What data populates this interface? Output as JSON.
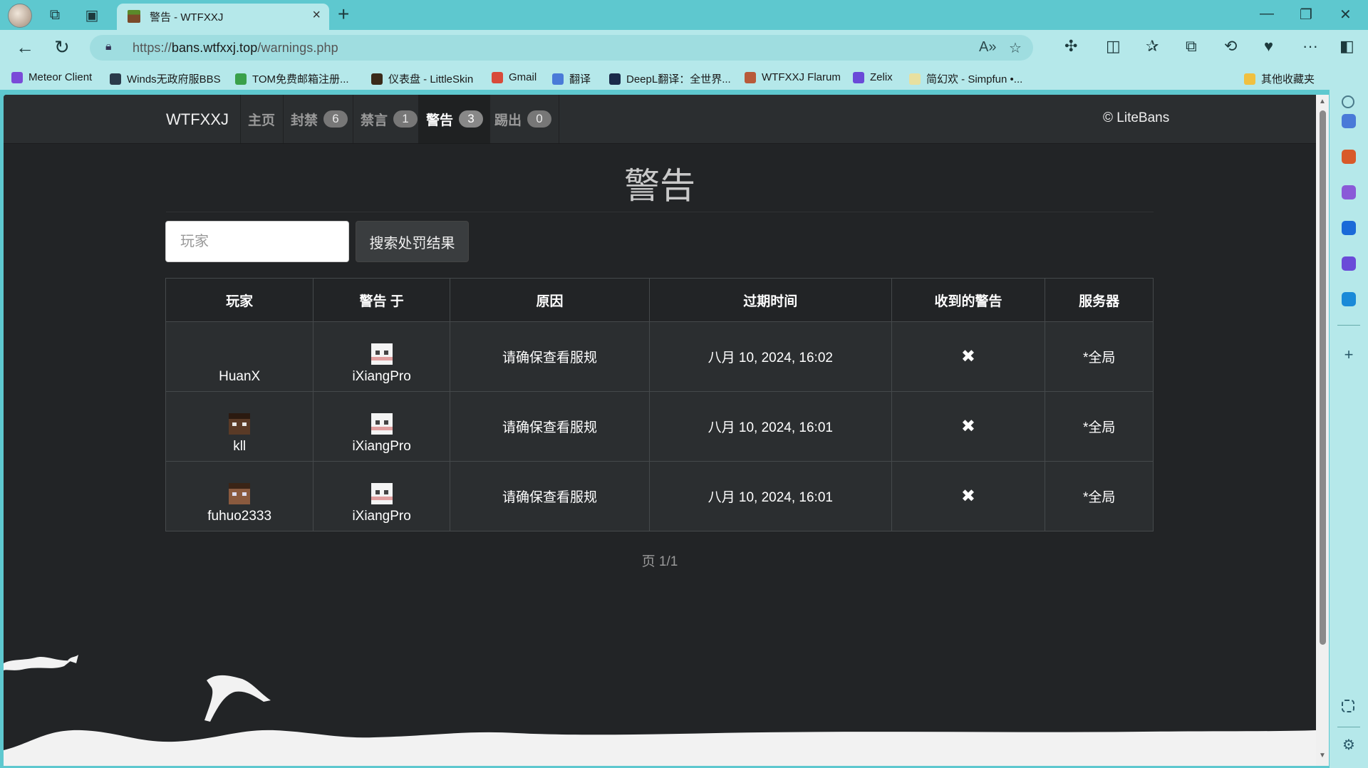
{
  "browser": {
    "tab_title": "警告 - WTFXXJ",
    "url_prefix": "https://",
    "url_host": "bans.wtfxxj.top",
    "url_path": "/warnings.php",
    "bookmarks": [
      {
        "label": "Meteor Client",
        "color": "#7a4bd8"
      },
      {
        "label": "Winds无政府服BBS",
        "color": "#2b3a4a"
      },
      {
        "label": "TOM免费邮箱注册...",
        "color": "#3aa04a"
      },
      {
        "label": "仪表盘 - LittleSkin",
        "color": "#3a2a1a"
      },
      {
        "label": "Gmail",
        "color": "#d84a3a"
      },
      {
        "label": "翻译",
        "color": "#4a7ad8"
      },
      {
        "label": "DeepL翻译：全世界...",
        "color": "#1a2a4a"
      },
      {
        "label": "WTFXXJ Flarum",
        "color": "#b85a3a"
      },
      {
        "label": "Zelix",
        "color": "#6a4ad8"
      },
      {
        "label": "简幻欢 - Simpfun •...",
        "color": "#e8e0a0"
      }
    ],
    "other_bookmarks": "其他收藏夹"
  },
  "site": {
    "brand": "WTFXXJ",
    "nav": [
      {
        "label": "主页",
        "count": ""
      },
      {
        "label": "封禁",
        "count": "6"
      },
      {
        "label": "禁言",
        "count": "1"
      },
      {
        "label": "警告",
        "count": "3"
      },
      {
        "label": "踢出",
        "count": "0"
      }
    ],
    "credit": "© LiteBans",
    "page_title": "警告",
    "search_placeholder": "玩家",
    "search_button": "搜索处罚结果",
    "columns": [
      "玩家",
      "警告 于",
      "原因",
      "过期时间",
      "收到的警告",
      "服务器"
    ],
    "rows": [
      {
        "player": "HuanX",
        "player_head": "blank",
        "by": "iXiangPro",
        "reason": "请确保查看服规",
        "expires": "八月 10, 2024, 16:02",
        "received": "✖",
        "server": "*全局"
      },
      {
        "player": "kll",
        "player_head": "dark",
        "by": "iXiangPro",
        "reason": "请确保查看服规",
        "expires": "八月 10, 2024, 16:01",
        "received": "✖",
        "server": "*全局"
      },
      {
        "player": "fuhuo2333",
        "player_head": "brown",
        "by": "iXiangPro",
        "reason": "请确保查看服规",
        "expires": "八月 10, 2024, 16:01",
        "received": "✖",
        "server": "*全局"
      }
    ],
    "pager": "页 1/1"
  }
}
